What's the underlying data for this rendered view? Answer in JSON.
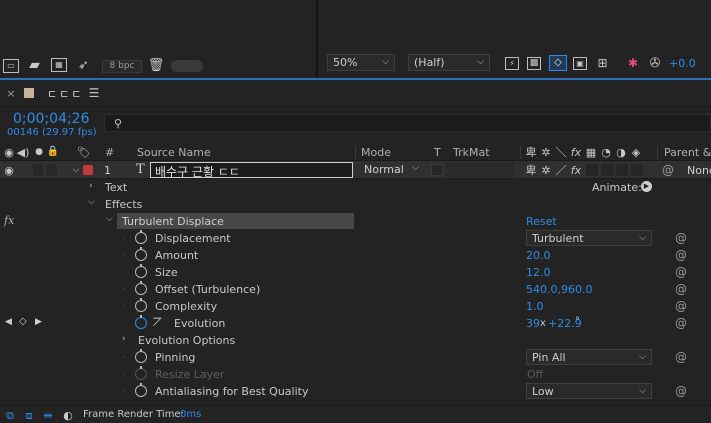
{
  "project_panel": {
    "bpc_label": "8 bpc"
  },
  "viewer": {
    "zoom": "50%",
    "resolution": "(Half)",
    "exposure": "+0.0"
  },
  "comp_tab": {
    "name": "ㄷㄷㄷ"
  },
  "timeline": {
    "timecode": "0;00;04;26",
    "frame_info": "00146 (29.97 fps)",
    "search_placeholder": "",
    "columns": {
      "hash": "#",
      "source_name": "Source Name",
      "mode": "Mode",
      "t": "T",
      "trkmat": "TrkMat",
      "parent": "Parent &"
    },
    "layer": {
      "number": "1",
      "type_icon": "T",
      "name": "배수구 근황 ㄷㄷ",
      "mode": "Normal",
      "parent": "None",
      "label_color": "#c0393b"
    },
    "groups": {
      "text": "Text",
      "effects": "Effects",
      "animate": "Animate:"
    },
    "effect": {
      "fx_label": "fx",
      "name": "Turbulent Displace",
      "reset": "Reset"
    },
    "properties": [
      {
        "name": "Displacement",
        "value": "Turbulent",
        "kind": "dropdown"
      },
      {
        "name": "Amount",
        "value": "20.0",
        "kind": "number"
      },
      {
        "name": "Size",
        "value": "12.0",
        "kind": "number"
      },
      {
        "name": "Offset (Turbulence)",
        "value": "540.0,960.0",
        "kind": "number"
      },
      {
        "name": "Complexity",
        "value": "1.0",
        "kind": "number"
      },
      {
        "name": "Evolution",
        "value": "39",
        "value_suffix": "x",
        "value_extra": "+22.9",
        "value_unit": "°",
        "kind": "angle"
      }
    ],
    "evolution_options": "Evolution Options",
    "pinning": {
      "name": "Pinning",
      "value": "Pin All"
    },
    "resize_layer": {
      "name": "Resize Layer",
      "value": "Off"
    },
    "antialiasing": {
      "name": "Antialiasing for Best Quality",
      "value": "Low"
    },
    "footer": {
      "label": "Frame Render Time:",
      "value": "0ms"
    }
  },
  "colors": {
    "accent_blue": "#2d8ceb",
    "highlight_row": "#474747",
    "panel_bg": "#232323"
  }
}
